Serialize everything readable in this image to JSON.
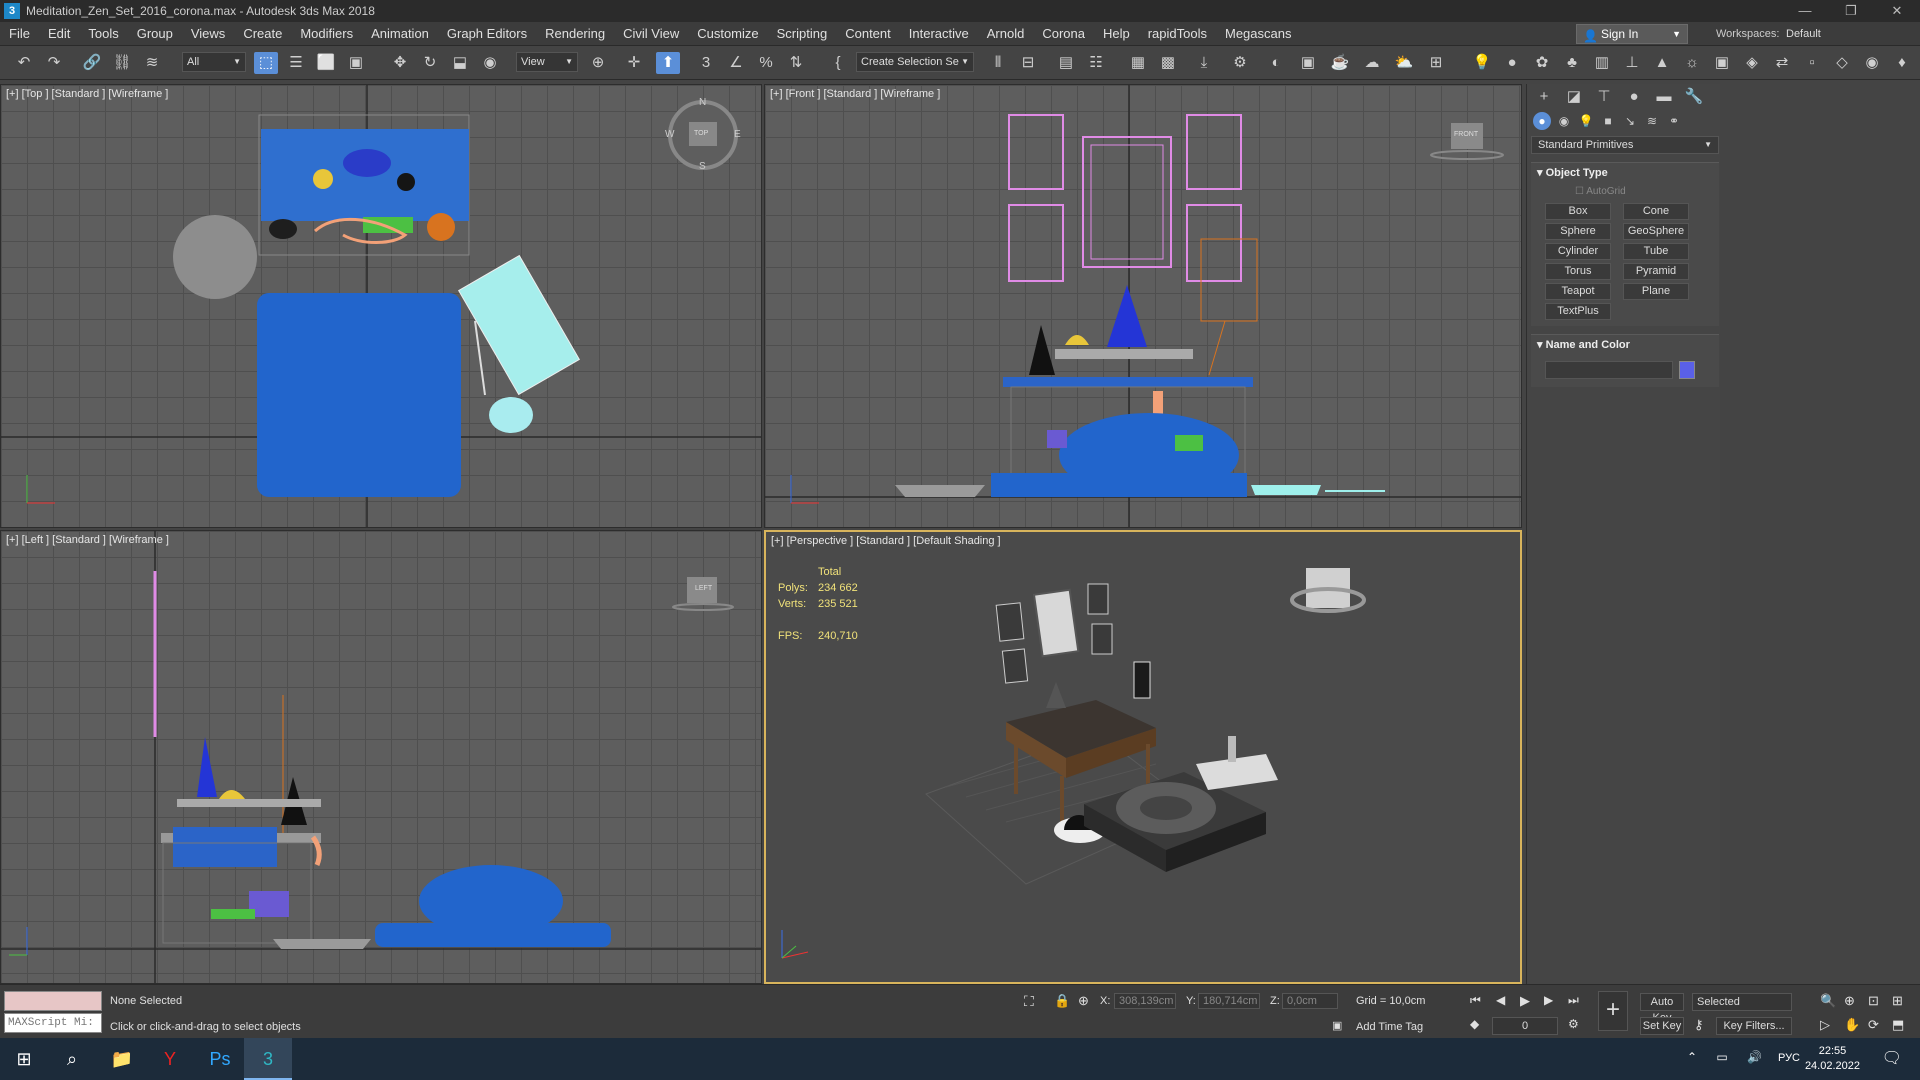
{
  "window": {
    "app_icon": "3",
    "title": "Meditation_Zen_Set_2016_corona.max - Autodesk 3ds Max 2018",
    "controls": [
      "—",
      "❐",
      "✕"
    ]
  },
  "menu": [
    "File",
    "Edit",
    "Tools",
    "Group",
    "Views",
    "Create",
    "Modifiers",
    "Animation",
    "Graph Editors",
    "Rendering",
    "Civil View",
    "Customize",
    "Scripting",
    "Content",
    "Interactive",
    "Arnold",
    "Corona",
    "Help",
    "rapidTools",
    "Megascans"
  ],
  "signin": {
    "label": "Sign In"
  },
  "workspaces": {
    "label": "Workspaces:",
    "value": "Default"
  },
  "toolbar": {
    "selection_filter": "All",
    "ref_coord": "View",
    "named_selection": "Create Selection Se"
  },
  "viewports": {
    "top": {
      "label": "[+] [Top ] [Standard ] [Wireframe ]",
      "nav": {
        "n": "N",
        "s": "S",
        "e": "E",
        "w": "W",
        "cube": "TOP"
      }
    },
    "front": {
      "label": "[+] [Front ] [Standard ] [Wireframe ]",
      "cube": "FRONT"
    },
    "left": {
      "label": "[+] [Left ] [Standard ] [Wireframe ]",
      "cube": "LEFT"
    },
    "perspective": {
      "label": "[+] [Perspective ] [Standard ] [Default Shading ]",
      "stats": {
        "header": "Total",
        "polys_label": "Polys:",
        "polys": "234 662",
        "verts_label": "Verts:",
        "verts": "235 521",
        "fps_label": "FPS:",
        "fps": "240,710"
      }
    }
  },
  "command_panel": {
    "primitive_type": "Standard Primitives",
    "object_type_title": "Object Type",
    "autogrid": "AutoGrid",
    "buttons": [
      "Box",
      "Cone",
      "Sphere",
      "GeoSphere",
      "Cylinder",
      "Tube",
      "Torus",
      "Pyramid",
      "Teapot",
      "Plane",
      "TextPlus"
    ],
    "name_color_title": "Name and Color",
    "color": "#5a60e8"
  },
  "status": {
    "maxscript_placeholder": "MAXScript Mi:",
    "selection": "None Selected",
    "prompt": "Click or click-and-drag to select objects",
    "x_label": "X:",
    "x": "308,139cm",
    "y_label": "Y:",
    "y": "180,714cm",
    "z_label": "Z:",
    "z": "0,0cm",
    "grid": "Grid = 10,0cm",
    "add_time_tag": "Add Time Tag",
    "auto_key": "Auto Key",
    "set_key": "Set Key",
    "key_mode": "Selected",
    "key_filters": "Key Filters...",
    "frame": "0"
  },
  "taskbar": {
    "time": "22:55",
    "date": "24.02.2022",
    "lang": "РУС"
  }
}
